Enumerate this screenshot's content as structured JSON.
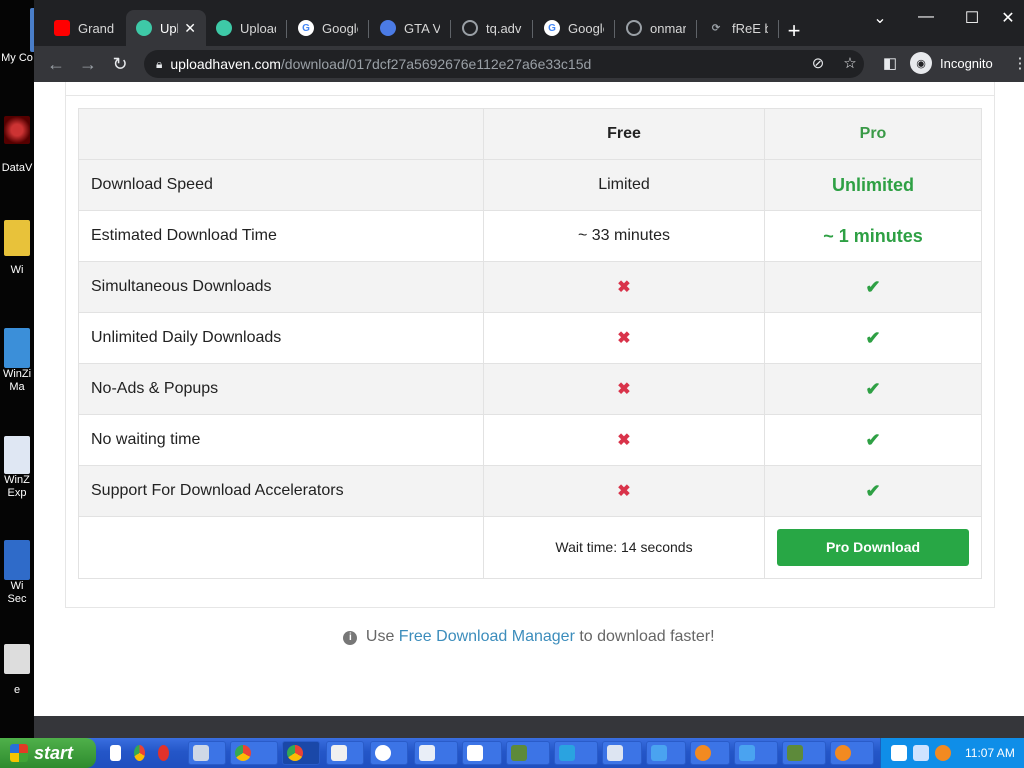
{
  "desktop": {
    "icons": [
      {
        "label": "My Co",
        "top": 0
      },
      {
        "label": "DataV",
        "top": 0
      },
      {
        "label": "Wi",
        "top": 0
      },
      {
        "label": "WinZi",
        "sub": "Ma"
      },
      {
        "label": "WinZ",
        "sub": "Exp"
      },
      {
        "label": "Wi",
        "sub": "Sec"
      },
      {
        "label": "e"
      }
    ]
  },
  "browser": {
    "tabs": [
      {
        "label": "Grand T",
        "icon": "youtube-icon",
        "color": "#ff0000"
      },
      {
        "label": "Upl",
        "icon": "cloud-icon",
        "color": "#3ec9a7",
        "active": true
      },
      {
        "label": "Upload",
        "icon": "cloud-icon",
        "color": "#3ec9a7"
      },
      {
        "label": "Google",
        "icon": "google-icon",
        "color": "#ffffff"
      },
      {
        "label": "GTA V R",
        "icon": "cloud-icon",
        "color": "#4b7be5"
      },
      {
        "label": "tq.adve",
        "icon": "globe-icon",
        "color": "#9aa0a6"
      },
      {
        "label": "Google",
        "icon": "google-icon",
        "color": "#ffffff"
      },
      {
        "label": "onmars",
        "icon": "globe-icon",
        "color": "#9aa0a6"
      },
      {
        "label": "fReE bC",
        "icon": "link-icon",
        "color": "#9aa0a6"
      }
    ],
    "new_tab": "+",
    "url": {
      "host": "uploadhaven.com",
      "path": "/download/017dcf27a5692676e112e27a6e33c15d"
    },
    "incognito_label": "Incognito"
  },
  "table": {
    "headers": {
      "feature": "",
      "free": "Free",
      "pro": "Pro"
    },
    "rows": [
      {
        "feature": "Download Speed",
        "free": "Limited",
        "pro": "Unlimited",
        "kind": "text"
      },
      {
        "feature": "Estimated Download Time",
        "free": "~ 33 minutes",
        "pro": "~ 1 minutes",
        "kind": "text"
      },
      {
        "feature": "Simultaneous Downloads",
        "free": "✖",
        "pro": "✔",
        "kind": "mark"
      },
      {
        "feature": "Unlimited Daily Downloads",
        "free": "✖",
        "pro": "✔",
        "kind": "mark"
      },
      {
        "feature": "No-Ads & Popups",
        "free": "✖",
        "pro": "✔",
        "kind": "mark"
      },
      {
        "feature": "No waiting time",
        "free": "✖",
        "pro": "✔",
        "kind": "mark"
      },
      {
        "feature": "Support For Download Accelerators",
        "free": "✖",
        "pro": "✔",
        "kind": "mark"
      }
    ],
    "wait_text": "Wait time: 14 seconds",
    "pro_button": "Pro Download"
  },
  "hint": {
    "prefix": "Use",
    "link": "Free Download Manager",
    "suffix": "to download faster!"
  },
  "taskbar": {
    "start_label": "start",
    "clock": "11:07 AM"
  }
}
